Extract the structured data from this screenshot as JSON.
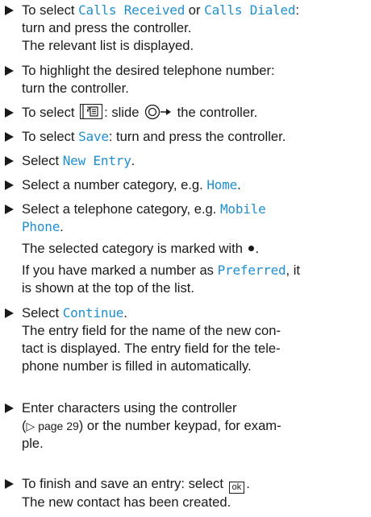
{
  "steps": [
    {
      "a": "To select ",
      "h1": "Calls Received",
      "b": " or ",
      "h2": "Calls Dialed",
      "c": ":",
      "d": "turn and press the controller.",
      "note": "The relevant list is displayed."
    },
    {
      "a": "To highlight the desired telephone number:",
      "b": "turn the controller."
    },
    {
      "a": "To select ",
      "b": ": slide ",
      "c": " the controller.",
      "key_icon": "phonebook-key-icon",
      "slide_icon": "slide-right-icon"
    },
    {
      "a": "To select ",
      "h": "Save",
      "b": ": turn and press the controller."
    },
    {
      "a": "Select ",
      "h": "New Entry",
      "b": "."
    },
    {
      "a": "Select a number category, e.g. ",
      "h": "Home",
      "b": "."
    },
    {
      "a": "Select a telephone category, e.g. ",
      "h1": "Mobile",
      "h2": "Phone",
      "b": ".",
      "note1": "The selected category is marked with ",
      "note1_end": ".",
      "note2a": "If you have marked a number as ",
      "note2h": "Preferred",
      "note2b": ", it",
      "note2c": "is shown at the top of the list."
    },
    {
      "a": "Select ",
      "h": "Continue",
      "b": ".",
      "n1": "The entry field for the name of the new con-",
      "n2": "tact is displayed. The entry field for the tele-",
      "n3": "phone number is filled in automatically."
    },
    {
      "a": "Enter characters using the controller",
      "b1": "(",
      "ref": "▷ page 29",
      "b2": ") or the number keypad, for exam-",
      "c": "ple."
    },
    {
      "a": "To finish and save an entry: select ",
      "ok": "ok",
      "b": ".",
      "note": "The new contact has been created."
    }
  ],
  "colors": {
    "highlight": "#1f8fd0",
    "text": "#1a1a1a"
  }
}
